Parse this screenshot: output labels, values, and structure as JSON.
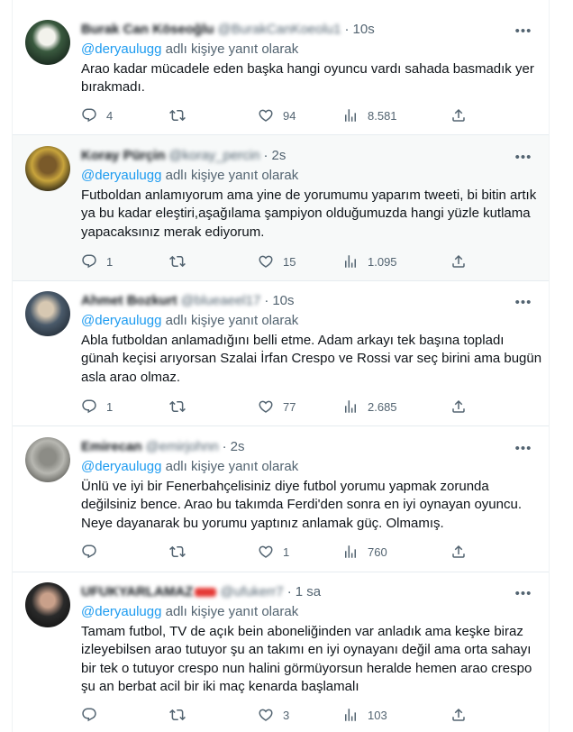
{
  "reply_prefix_suffix": "adlı kişiye yanıt olarak",
  "accent_color": "#1d9bf0",
  "tweets": [
    {
      "name": "Burak Can Köseoğlu",
      "handle": "@BurakCanKoeolu1",
      "time": "10s",
      "reply_to": "@deryaulugg",
      "text": "Arao kadar mücadele eden başka hangi oyuncu vardı sahada basmadık yer bırakmadı.",
      "replies": "4",
      "retweets": "",
      "likes": "94",
      "views": "8.581"
    },
    {
      "name": "Koray Pürçin",
      "handle": "@koray_percin",
      "time": "2s",
      "reply_to": "@deryaulugg",
      "text": "Futboldan anlamıyorum ama yine de yorumumu yaparım tweeti, bi bitin artık ya bu kadar eleştiri,aşağılama şampiyon olduğumuzda hangi yüzle kutlama yapacaksınız merak ediyorum.",
      "replies": "1",
      "retweets": "",
      "likes": "15",
      "views": "1.095"
    },
    {
      "name": "Ahmet Bozkurt",
      "handle": "@blueaeel17",
      "time": "10s",
      "reply_to": "@deryaulugg",
      "text": "Abla futboldan anlamadığını belli etme. Adam arkayı tek başına topladı günah keçisi arıyorsan Szalai İrfan Crespo ve Rossi var seç birini ama bugün asla arao olmaz.",
      "replies": "1",
      "retweets": "",
      "likes": "77",
      "views": "2.685"
    },
    {
      "name": "Emirecan",
      "handle": "@emirjohnn",
      "time": "2s",
      "reply_to": "@deryaulugg",
      "text": "Ünlü ve iyi bir Fenerbahçelisiniz diye futbol yorumu yapmak zorunda değilsiniz bence. Arao bu takımda Ferdi'den sonra en iyi oynayan oyuncu. Neye dayanarak bu yorumu yaptınız anlamak güç. Olmamış.",
      "replies": "",
      "retweets": "",
      "likes": "1",
      "views": "760"
    },
    {
      "name": "UFUKYARLAMAZ",
      "handle": "@ufukerr7",
      "time": "1 sa",
      "reply_to": "@deryaulugg",
      "text": "Tamam futbol, TV de açık bein aboneliğinden var anladık ama keşke biraz izleyebilsen arao tutuyor şu an takımı en iyi oynayanı değil ama orta sahayı bir tek o tutuyor crespo nun halini görmüyorsun heralde hemen arao crespo şu an berbat acil bir iki maç kenarda başlamalı",
      "replies": "",
      "retweets": "",
      "likes": "3",
      "views": "103"
    }
  ]
}
